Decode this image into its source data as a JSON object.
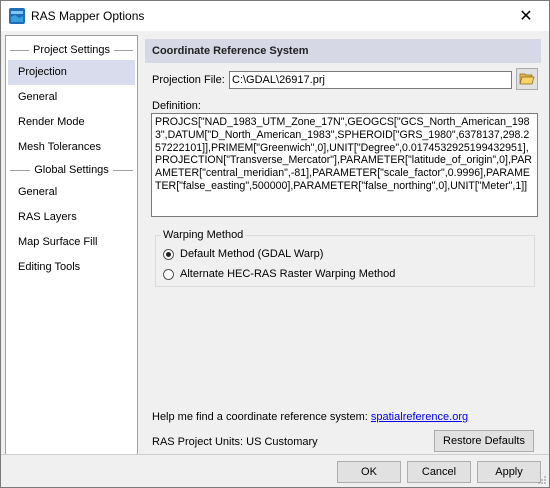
{
  "window": {
    "title": "RAS Mapper Options",
    "close_label": "✕"
  },
  "nav": {
    "project_section": "Project Settings",
    "project_items": [
      {
        "label": "Projection",
        "selected": true
      },
      {
        "label": "General",
        "selected": false
      },
      {
        "label": "Render Mode",
        "selected": false
      },
      {
        "label": "Mesh Tolerances",
        "selected": false
      }
    ],
    "global_section": "Global Settings",
    "global_items": [
      {
        "label": "General"
      },
      {
        "label": "RAS Layers"
      },
      {
        "label": "Map Surface Fill"
      },
      {
        "label": "Editing Tools"
      }
    ]
  },
  "panel": {
    "header": "Coordinate Reference System",
    "projection_file_label": "Projection File:",
    "projection_file_value": "C:\\GDAL\\26917.prj",
    "definition_label": "Definition:",
    "definition_text": "PROJCS[\"NAD_1983_UTM_Zone_17N\",GEOGCS[\"GCS_North_American_1983\",DATUM[\"D_North_American_1983\",SPHEROID[\"GRS_1980\",6378137,298.257222101]],PRIMEM[\"Greenwich\",0],UNIT[\"Degree\",0.0174532925199432951],PROJECTION[\"Transverse_Mercator\"],PARAMETER[\"latitude_of_origin\",0],PARAMETER[\"central_meridian\",-81],PARAMETER[\"scale_factor\",0.9996],PARAMETER[\"false_easting\",500000],PARAMETER[\"false_northing\",0],UNIT[\"Meter\",1]]",
    "warping": {
      "legend": "Warping Method",
      "option_default": "Default Method (GDAL Warp)",
      "option_alternate": "Alternate HEC-RAS Raster Warping Method",
      "selected": "default"
    },
    "help_text": "Help me find a coordinate reference system:",
    "help_link": "spatialreference.org",
    "units_text": "RAS Project Units: US Customary",
    "restore_label": "Restore Defaults"
  },
  "buttons": {
    "ok": "OK",
    "cancel": "Cancel",
    "apply": "Apply"
  }
}
